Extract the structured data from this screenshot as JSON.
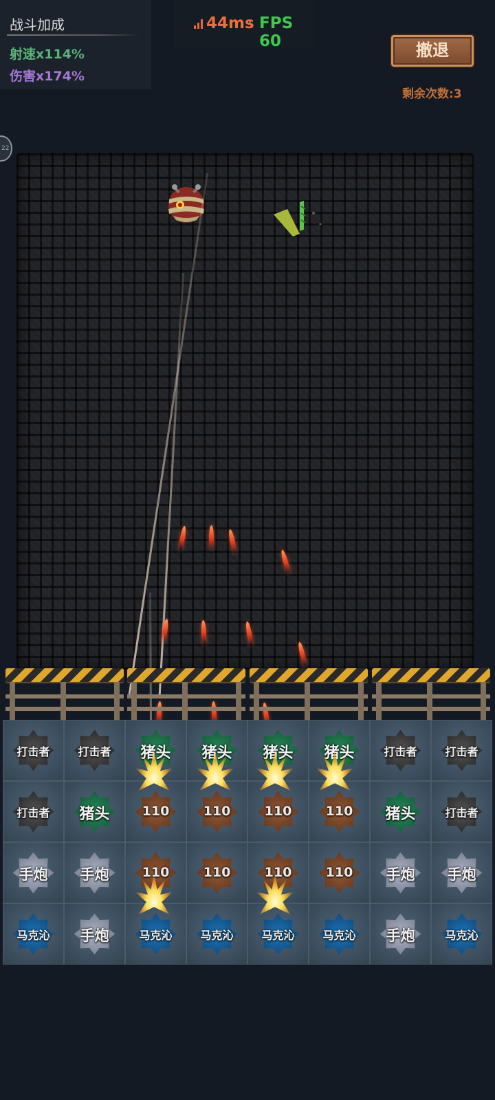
{
  "stats": {
    "title": "战斗加成",
    "fire_rate": "射速x114%",
    "damage": "伤害x174%"
  },
  "network": {
    "ping": "44ms",
    "separator": "·",
    "fps": "FPS 60",
    "ping_color": "#ef6d3c",
    "fps_color": "#3ec84e"
  },
  "retreat_button": "撤退",
  "remaining": "剩余次数:3",
  "side_badge": "22",
  "icons": {
    "signal": "signal-bars-icon",
    "enemy_mummy": "mummy-ball-enemy",
    "enemy_bug": "green-insect-enemy"
  },
  "grid": {
    "rows": [
      [
        {
          "label": "打击者",
          "type": "hitter"
        },
        {
          "label": "打击者",
          "type": "hitter"
        },
        {
          "label": "猪头",
          "type": "pig"
        },
        {
          "label": "猪头",
          "type": "pig"
        },
        {
          "label": "猪头",
          "type": "pig"
        },
        {
          "label": "猪头",
          "type": "pig"
        },
        {
          "label": "打击者",
          "type": "hitter"
        },
        {
          "label": "打击者",
          "type": "hitter"
        }
      ],
      [
        {
          "label": "打击者",
          "type": "hitter"
        },
        {
          "label": "猪头",
          "type": "pig"
        },
        {
          "label": "110",
          "type": "110"
        },
        {
          "label": "110",
          "type": "110"
        },
        {
          "label": "110",
          "type": "110"
        },
        {
          "label": "110",
          "type": "110"
        },
        {
          "label": "猪头",
          "type": "pig"
        },
        {
          "label": "打击者",
          "type": "hitter"
        }
      ],
      [
        {
          "label": "手炮",
          "type": "cannon"
        },
        {
          "label": "手炮",
          "type": "cannon"
        },
        {
          "label": "110",
          "type": "110"
        },
        {
          "label": "110",
          "type": "110"
        },
        {
          "label": "110",
          "type": "110"
        },
        {
          "label": "110",
          "type": "110"
        },
        {
          "label": "手炮",
          "type": "cannon"
        },
        {
          "label": "手炮",
          "type": "cannon"
        }
      ],
      [
        {
          "label": "马克沁",
          "type": "mark"
        },
        {
          "label": "手炮",
          "type": "cannon"
        },
        {
          "label": "马克沁",
          "type": "mark"
        },
        {
          "label": "马克沁",
          "type": "mark"
        },
        {
          "label": "马克沁",
          "type": "mark"
        },
        {
          "label": "马克沁",
          "type": "mark"
        },
        {
          "label": "手炮",
          "type": "cannon"
        },
        {
          "label": "马克沁",
          "type": "mark"
        }
      ]
    ]
  }
}
